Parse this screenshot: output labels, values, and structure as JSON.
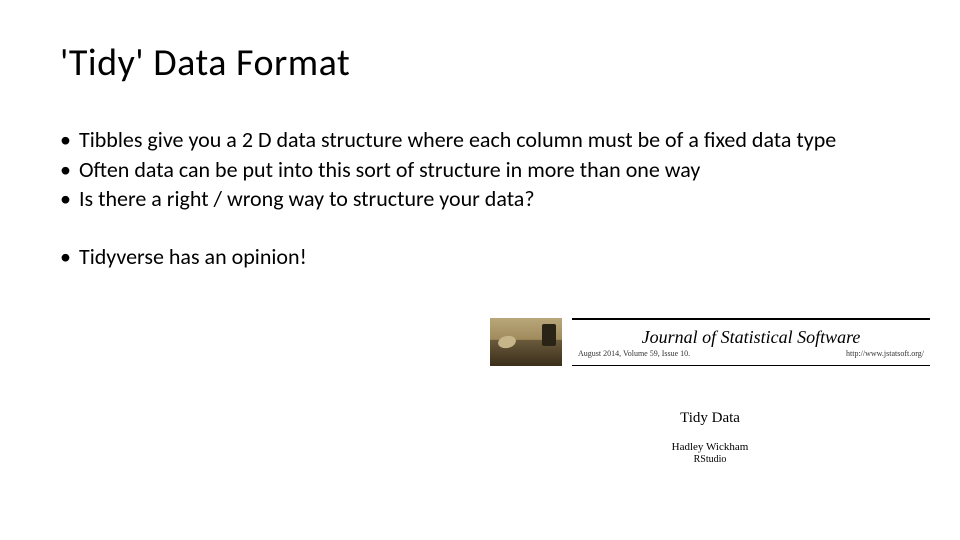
{
  "title": "'Tidy' Data Format",
  "bullets_top": [
    "Tibbles give you a 2 D data structure where each column must be of a fixed data type",
    "Often data can be put into this sort of structure in more than one way",
    "Is there a right / wrong way to structure your data?"
  ],
  "bullets_bottom": [
    "Tidyverse has an opinion!"
  ],
  "journal": {
    "name": "Journal of Statistical Software",
    "issue": "August 2014, Volume 59, Issue 10.",
    "url": "http://www.jstatsoft.org/"
  },
  "paper": {
    "title": "Tidy Data",
    "author": "Hadley Wickham",
    "affiliation": "RStudio"
  }
}
